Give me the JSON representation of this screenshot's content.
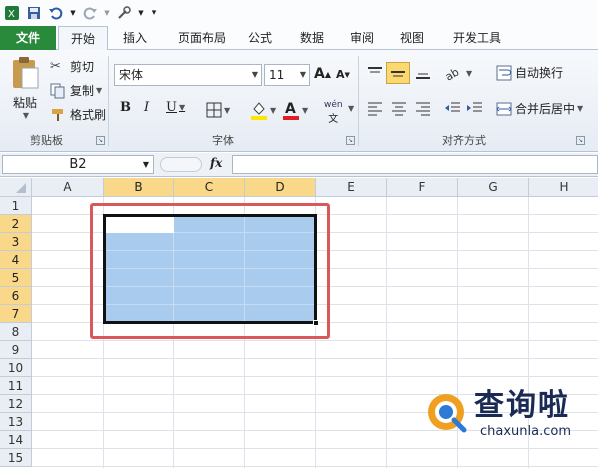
{
  "tabs": [
    "文件",
    "开始",
    "插入",
    "页面布局",
    "公式",
    "数据",
    "审阅",
    "视图",
    "开发工具"
  ],
  "active_tab": "开始",
  "clipboard": {
    "paste": "粘贴",
    "cut": "剪切",
    "copy": "复制",
    "format_painter": "格式刷",
    "group": "剪贴板"
  },
  "font": {
    "name": "宋体",
    "size": "11",
    "bold": "B",
    "italic": "I",
    "underline": "U",
    "group": "字体",
    "grow": "A",
    "shrink": "A",
    "phonetic": "wén"
  },
  "alignment": {
    "wrap_text": "自动换行",
    "merge_center": "合并后居中",
    "group": "对齐方式"
  },
  "formula_bar": {
    "name_box": "B2",
    "fx": "fx"
  },
  "columns": [
    "A",
    "B",
    "C",
    "D",
    "E",
    "F",
    "G",
    "H"
  ],
  "rows": [
    "1",
    "2",
    "3",
    "4",
    "5",
    "6",
    "7",
    "8",
    "9",
    "10",
    "11",
    "12",
    "13",
    "14",
    "15"
  ],
  "selection": {
    "range": "B2:D7",
    "active_cell": "B2"
  },
  "colors": {
    "file_tab": "#2a8a3c",
    "selection_fill": "#a9cbee",
    "header_selected": "#f9d889",
    "highlight_box": "#d8585c"
  },
  "watermark": {
    "text": "查询啦",
    "sub": "chaxunla.com"
  }
}
